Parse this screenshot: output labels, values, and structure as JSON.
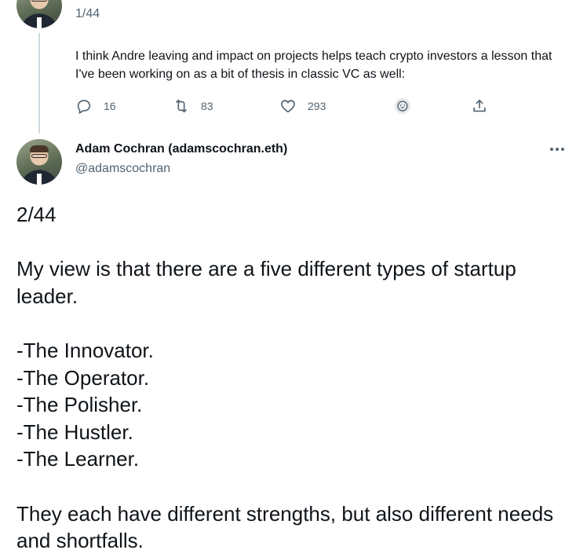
{
  "previous_tweet": {
    "counter": "1/44",
    "body": "I think Andre leaving and impact on projects helps teach crypto investors a lesson that I've been working on as a bit of thesis in classic VC as well:",
    "actions": {
      "reply_count": "16",
      "retweet_count": "83",
      "like_count": "293"
    },
    "icons": {
      "reply": "reply-icon",
      "retweet": "retweet-icon",
      "like": "heart-icon",
      "reaction": "emoji-icon",
      "share": "share-icon"
    }
  },
  "current_tweet": {
    "author_name": "Adam Cochran (adamscochran.eth)",
    "author_handle": "@adamscochran",
    "counter": "2/44",
    "intro": "My view is that there are a five different types of startup leader.",
    "types": [
      "-The Innovator.",
      "-The Operator.",
      "-The Polisher.",
      "-The Hustler.",
      "-The Learner."
    ],
    "closing": "They each have different strengths, but also different needs and shortfalls."
  },
  "colors": {
    "text_primary": "#0f1419",
    "text_secondary": "#536471",
    "thread_line": "#cfd9de"
  }
}
